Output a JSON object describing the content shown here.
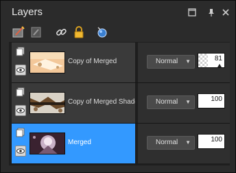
{
  "window": {
    "title": "Layers",
    "controls": [
      "maximize-icon",
      "pin-icon",
      "close-icon"
    ]
  },
  "toolbar": {
    "tools": [
      "new-raster-layer-icon",
      "new-mask-layer-icon",
      "link-icon",
      "lock-icon",
      "edit-selection-icon"
    ]
  },
  "layers": [
    {
      "name": "Copy of Merged",
      "blend_mode": "Normal",
      "opacity": "81",
      "opacity_fraction": 0.81,
      "selected": false,
      "visible": true,
      "type_icon": "raster-layer-icon"
    },
    {
      "name": "Copy of Merged Shadow",
      "blend_mode": "Normal",
      "opacity": "100",
      "opacity_fraction": 1.0,
      "selected": false,
      "visible": true,
      "type_icon": "raster-layer-icon"
    },
    {
      "name": "Merged",
      "blend_mode": "Normal",
      "opacity": "100",
      "opacity_fraction": 1.0,
      "selected": true,
      "visible": true,
      "type_icon": "raster-layer-icon"
    }
  ],
  "colors": {
    "selection": "#3399ff",
    "panel_bg": "#2b2b2b",
    "row_bg": "#3a3a3a"
  }
}
